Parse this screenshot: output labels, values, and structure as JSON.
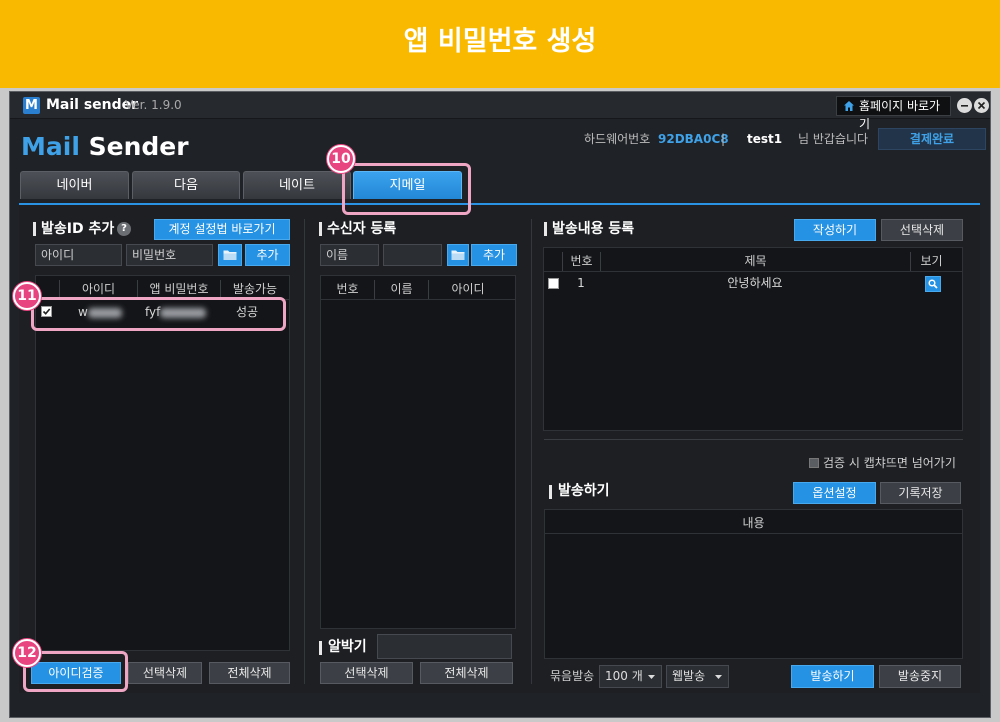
{
  "banner": {
    "title": "앱 비밀번호 생성"
  },
  "titlebar": {
    "logo_letter": "M",
    "app_name": "Mail sender",
    "version": "Ver. 1.9.0",
    "homepage_label": "홈페이지 바로가기"
  },
  "header": {
    "logo_mail": "Mail",
    "logo_sender": "Sender",
    "hardware_label": "하드웨어번호",
    "hardware_id": "92DBA0C8",
    "separator": "|",
    "username": "test1",
    "greeting": "님 반갑습니다",
    "payment_status": "결제완료"
  },
  "tabs": [
    {
      "label": "네이버",
      "active": false
    },
    {
      "label": "다음",
      "active": false
    },
    {
      "label": "네이트",
      "active": false
    },
    {
      "label": "지메일",
      "active": true
    }
  ],
  "callouts": [
    "10",
    "11",
    "12"
  ],
  "sender_panel": {
    "title": "발송ID 추가",
    "help_glyph": "?",
    "guide_button": "계정 설정법 바로가기",
    "id_placeholder": "아이디",
    "password_placeholder": "비밀번호",
    "add_button": "추가",
    "columns": [
      "아이디",
      "앱 비밀번호",
      "발송가능"
    ],
    "rows": [
      {
        "checked": true,
        "id": "w",
        "app_password": "fyf",
        "status": "성공"
      }
    ],
    "verify_button": "아이디검증",
    "delete_selected": "선택삭제",
    "delete_all": "전체삭제"
  },
  "recipient_panel": {
    "title": "수신자 등록",
    "name_placeholder": "이름",
    "add_button": "추가",
    "columns": [
      "번호",
      "이름",
      "아이디"
    ],
    "albak_label": "알박기",
    "delete_selected": "선택삭제",
    "delete_all": "전체삭제"
  },
  "content_panel": {
    "title": "발송내용 등록",
    "write_button": "작성하기",
    "delete_selected": "선택삭제",
    "columns": [
      "번호",
      "제목",
      "보기"
    ],
    "rows": [
      {
        "checked": false,
        "number": "1",
        "subject": "안녕하세요"
      }
    ]
  },
  "send_panel": {
    "captcha_skip_label": "검증 시 캡챠뜨면 넘어가기",
    "captcha_skip_checked": false,
    "title": "발송하기",
    "options_button": "옵션설정",
    "save_log_button": "기록저장",
    "columns": [
      "내용"
    ],
    "batch_label": "묶음발송",
    "batch_size": "100 개",
    "send_mode": "웹발송",
    "send_button": "발송하기",
    "stop_button": "발송중지"
  },
  "colors": {
    "banner": "#f8b900",
    "accent": "#2592e3",
    "callout": "#e8447f",
    "highlight": "#efa6c5",
    "window_bg": "#1f2226"
  }
}
